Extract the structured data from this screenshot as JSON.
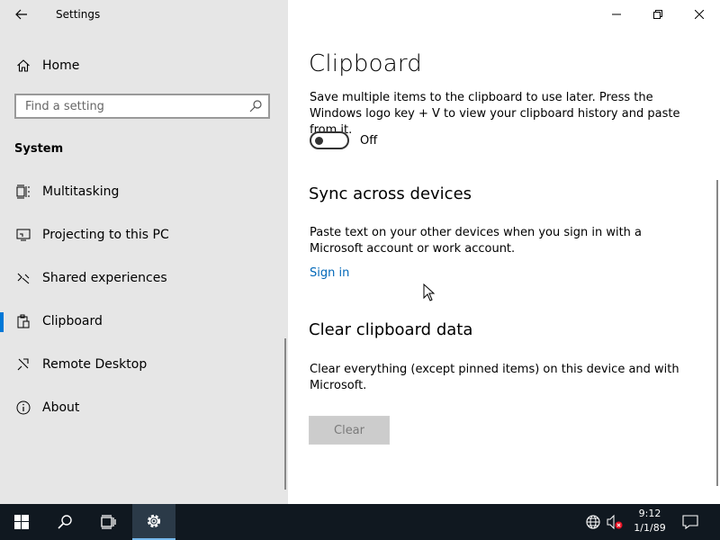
{
  "window": {
    "title": "Settings"
  },
  "sidebar": {
    "home_label": "Home",
    "search": {
      "placeholder": "Find a setting"
    },
    "section_heading": "System",
    "items": [
      {
        "label": "Multitasking",
        "icon": "multitasking-icon"
      },
      {
        "label": "Projecting to this PC",
        "icon": "projecting-icon"
      },
      {
        "label": "Shared experiences",
        "icon": "shared-experiences-icon"
      },
      {
        "label": "Clipboard",
        "icon": "clipboard-icon",
        "selected": true
      },
      {
        "label": "Remote Desktop",
        "icon": "remote-desktop-icon"
      },
      {
        "label": "About",
        "icon": "info-icon"
      }
    ]
  },
  "main": {
    "title": "Clipboard",
    "history": {
      "description": "Save multiple items to the clipboard to use later. Press the Windows logo key + V to view your clipboard history and paste from it.",
      "toggle_state": "Off"
    },
    "sync": {
      "heading": "Sync across devices",
      "description": "Paste text on your other devices when you sign in with a Microsoft account or work account.",
      "link": "Sign in"
    },
    "clear": {
      "heading": "Clear clipboard data",
      "description": "Clear everything (except pinned items) on this device and with Microsoft.",
      "button": "Clear"
    }
  },
  "taskbar": {
    "time": "9:12",
    "date": "1/1/89"
  },
  "colors": {
    "accent": "#0078d7",
    "link": "#0067b8",
    "sidebar_bg": "#e6e6e6",
    "taskbar_bg": "#101820"
  }
}
